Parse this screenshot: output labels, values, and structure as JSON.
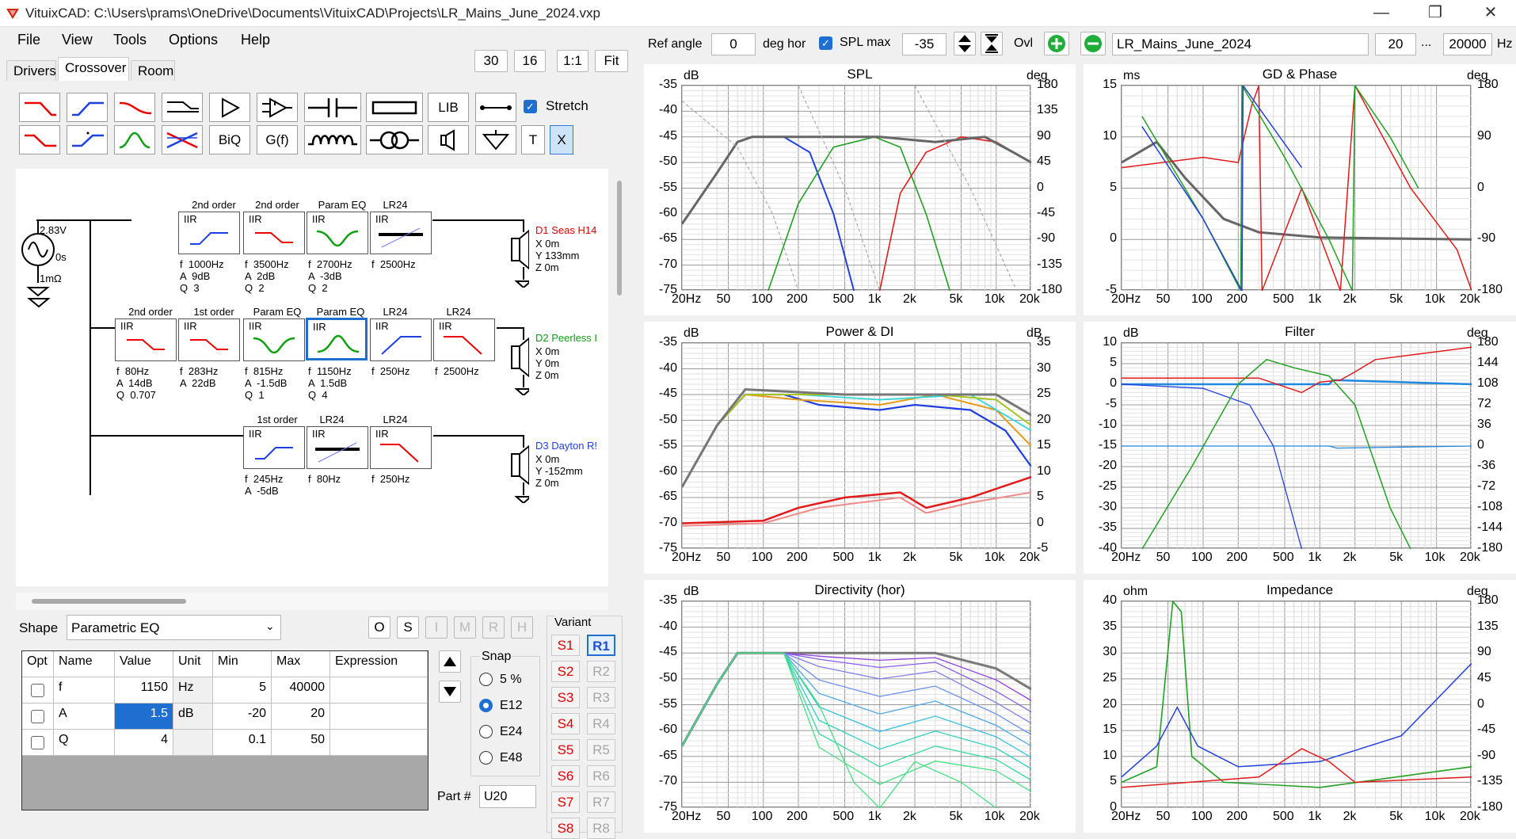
{
  "window": {
    "title": "VituixCAD: C:\\Users\\prams\\OneDrive\\Documents\\VituixCAD\\Projects\\LR_Mains_June_2024.vxp",
    "minimize": "—",
    "restore": "❐",
    "close": "✕"
  },
  "menu": [
    "File",
    "View",
    "Tools",
    "Options",
    "Help"
  ],
  "tabs": {
    "drivers": "Drivers",
    "crossover": "Crossover",
    "room": "Room"
  },
  "zoom_buttons": {
    "b30": "30",
    "b16": "16",
    "b11": "1:1",
    "fit": "Fit"
  },
  "toolbar": {
    "lib": "LIB",
    "biq": "BiQ",
    "gf": "G(f)",
    "t": "T",
    "x": "X",
    "stretch_label": "Stretch"
  },
  "circuit": {
    "source": {
      "voltage": "2.83V",
      "delay": "0s",
      "impedance": "1mΩ"
    },
    "row1": [
      {
        "type": "2nd order",
        "iir": "IIR",
        "params": "f  1000Hz\nA  9dB\nQ  3"
      },
      {
        "type": "2nd order",
        "iir": "IIR",
        "params": "f  3500Hz\nA  2dB\nQ  2"
      },
      {
        "type": "Param EQ",
        "iir": "IIR",
        "params": "f  2700Hz\nA  -3dB\nQ  2"
      },
      {
        "type": "LR24",
        "iir": "IIR",
        "params": "f  2500Hz"
      }
    ],
    "row2": [
      {
        "type": "2nd order",
        "iir": "IIR",
        "params": "f  80Hz\nA  14dB\nQ  0.707"
      },
      {
        "type": "1st order",
        "iir": "IIR",
        "params": "f  283Hz\nA  22dB"
      },
      {
        "type": "Param EQ",
        "iir": "IIR",
        "params": "f  815Hz\nA  -1.5dB\nQ  1"
      },
      {
        "type": "Param EQ",
        "iir": "IIR",
        "params": "f  1150Hz\nA  1.5dB\nQ  4"
      },
      {
        "type": "LR24",
        "iir": "IIR",
        "params": "f  250Hz"
      },
      {
        "type": "LR24",
        "iir": "IIR",
        "params": "f  2500Hz"
      }
    ],
    "row3": [
      {
        "type": "1st order",
        "iir": "IIR",
        "params": "f  245Hz\nA  -5dB"
      },
      {
        "type": "LR24",
        "iir": "IIR",
        "params": "f  80Hz"
      },
      {
        "type": "LR24",
        "iir": "IIR",
        "params": "f  250Hz"
      }
    ],
    "drivers": [
      {
        "name": "D1 Seas H14",
        "color": "#e00000",
        "params": "X 0m\nY 133mm\nZ 0m"
      },
      {
        "name": "D2 Peerless I",
        "color": "#10a010",
        "params": "X 0m\nY 0m\nZ 0m"
      },
      {
        "name": "D3 Dayton R!",
        "color": "#1f40e0",
        "params": "X 0m\nY -152mm\nZ 0m"
      }
    ]
  },
  "shape": {
    "label": "Shape",
    "value": "Parametric EQ"
  },
  "oms_buttons": [
    "O",
    "S",
    "I",
    "M",
    "R",
    "H"
  ],
  "param_table": {
    "headers": [
      "Opt",
      "Name",
      "Value",
      "Unit",
      "Min",
      "Max",
      "Expression"
    ],
    "rows": [
      {
        "name": "f",
        "value": "1150",
        "unit": "Hz",
        "min": "5",
        "max": "40000",
        "expr": ""
      },
      {
        "name": "A",
        "value": "1.5",
        "unit": "dB",
        "min": "-20",
        "max": "20",
        "expr": ""
      },
      {
        "name": "Q",
        "value": "4",
        "unit": "",
        "min": "0.1",
        "max": "50",
        "expr": ""
      }
    ]
  },
  "snap": {
    "label": "Snap",
    "options": [
      "5 %",
      "E12",
      "E24",
      "E48"
    ],
    "selected": "E12"
  },
  "part": {
    "label": "Part #",
    "value": "U20"
  },
  "variant": {
    "label": "Variant",
    "s": [
      "S1",
      "S2",
      "S3",
      "S4",
      "S5",
      "S6",
      "S7",
      "S8"
    ],
    "r": [
      "R1",
      "R2",
      "R3",
      "R4",
      "R5",
      "R6",
      "R7",
      "R8"
    ]
  },
  "topbar": {
    "ref_angle_label": "Ref angle",
    "ref_angle": "0",
    "deg_hor": "deg hor",
    "spl_max_label": "SPL max",
    "spl_max": "-35",
    "ovl": "Ovl",
    "project": "LR_Mains_June_2024",
    "f_min": "20",
    "dots": "...",
    "f_max": "20000",
    "hz": "Hz"
  },
  "graphs": {
    "spl": {
      "title": "SPL",
      "left_unit": "dB",
      "right_unit": "deg",
      "left_ticks": [
        "-35",
        "-40",
        "-45",
        "-50",
        "-55",
        "-60",
        "-65",
        "-70",
        "-75"
      ],
      "right_ticks": [
        "180",
        "135",
        "90",
        "45",
        "0",
        "-45",
        "-90",
        "-135",
        "-180"
      ]
    },
    "gd": {
      "title": "GD & Phase",
      "left_unit": "ms",
      "right_unit": "deg",
      "left_ticks": [
        "15",
        "10",
        "5",
        "0",
        "-5"
      ],
      "right_ticks": [
        "180",
        "90",
        "0",
        "-90",
        "-180"
      ]
    },
    "power": {
      "title": "Power & DI",
      "left_unit": "dB",
      "right_unit": "dB",
      "left_ticks": [
        "-35",
        "-40",
        "-45",
        "-50",
        "-55",
        "-60",
        "-65",
        "-70",
        "-75"
      ],
      "right_ticks": [
        "35",
        "30",
        "25",
        "20",
        "15",
        "10",
        "5",
        "0",
        "-5"
      ]
    },
    "filter": {
      "title": "Filter",
      "left_unit": "dB",
      "right_unit": "deg",
      "left_ticks": [
        "10",
        "5",
        "0",
        "-5",
        "-10",
        "-15",
        "-20",
        "-25",
        "-30",
        "-35",
        "-40"
      ],
      "right_ticks": [
        "180",
        "144",
        "108",
        "72",
        "36",
        "0",
        "-36",
        "-72",
        "-108",
        "-144",
        "-180"
      ]
    },
    "directivity": {
      "title": "Directivity (hor)",
      "left_unit": "dB",
      "right_unit": "",
      "left_ticks": [
        "-35",
        "-40",
        "-45",
        "-50",
        "-55",
        "-60",
        "-65",
        "-70",
        "-75"
      ],
      "right_ticks": []
    },
    "impedance": {
      "title": "Impedance",
      "left_unit": "ohm",
      "right_unit": "deg",
      "left_ticks": [
        "40",
        "35",
        "30",
        "25",
        "20",
        "15",
        "10",
        "5",
        "0"
      ],
      "right_ticks": [
        "180",
        "135",
        "90",
        "45",
        "0",
        "-45",
        "-90",
        "-135",
        "-180"
      ]
    },
    "freq_ticks": [
      "20Hz",
      "50",
      "100",
      "200",
      "500",
      "1k",
      "2k",
      "5k",
      "10k",
      "20k"
    ]
  }
}
